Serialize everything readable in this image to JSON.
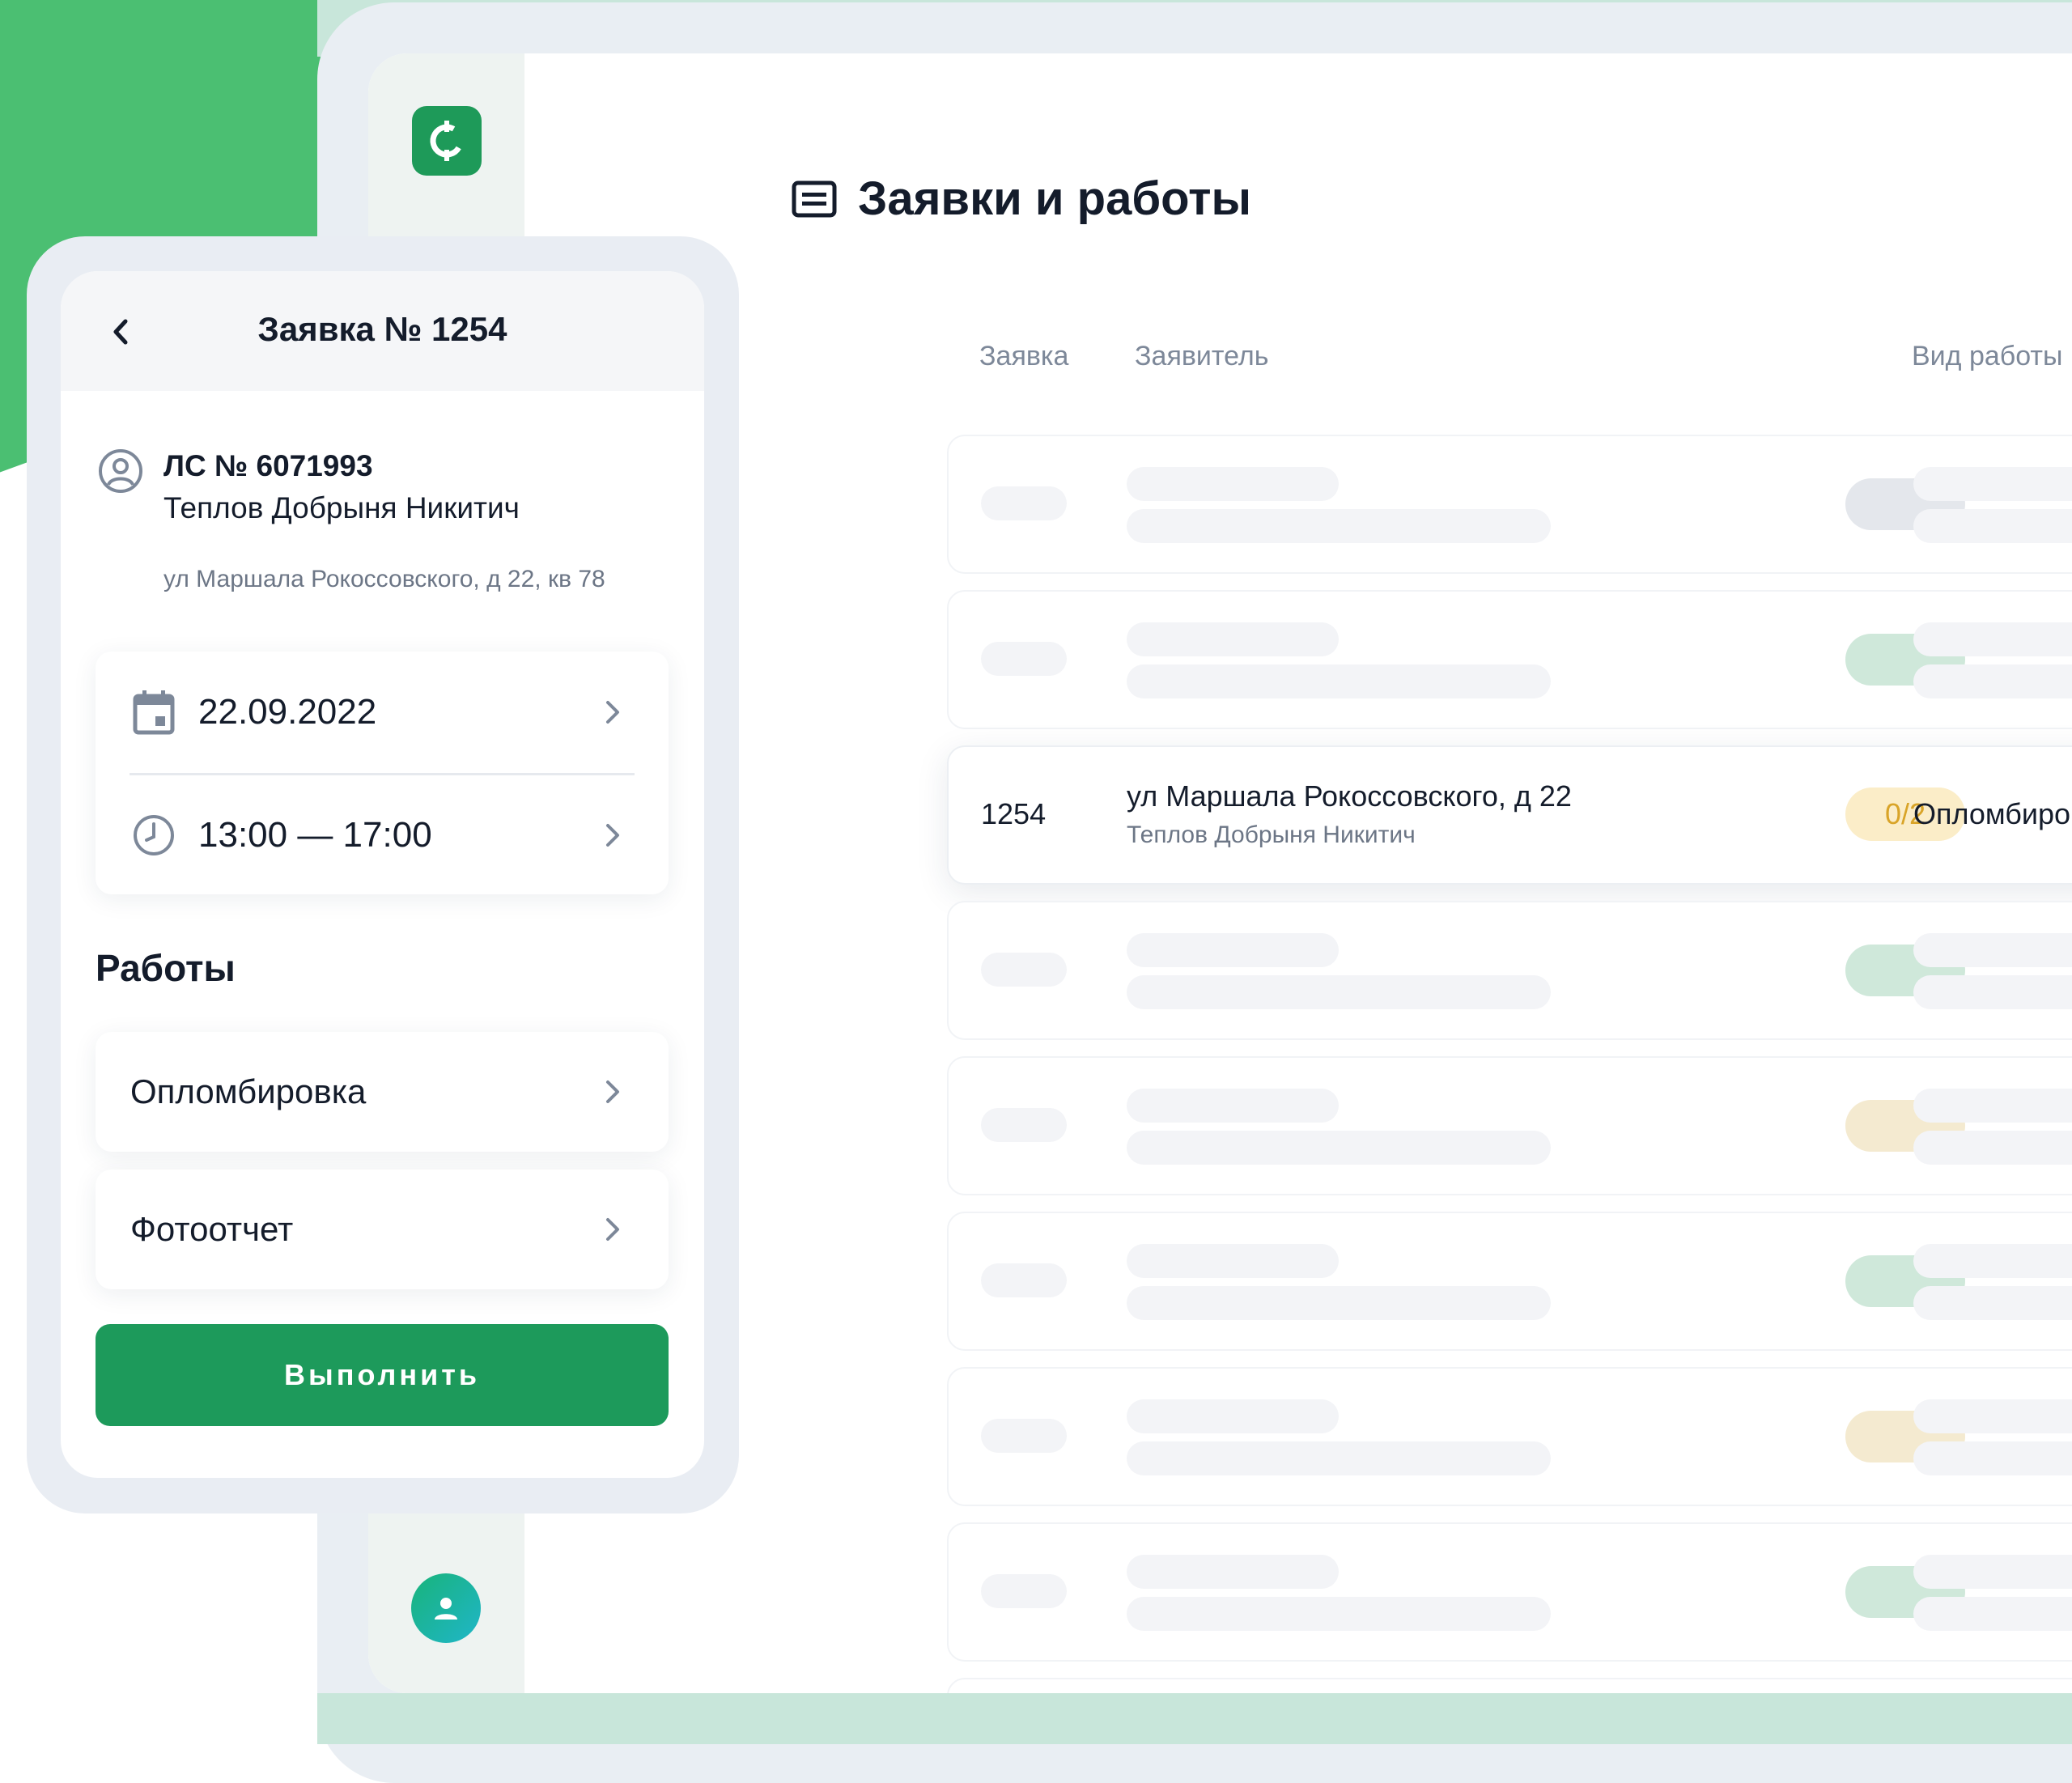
{
  "colors": {
    "brand_green": "#1d9a5b",
    "accent_green": "#4bbf72",
    "status_yellow_bg": "#fbedc8",
    "status_yellow_text": "#d9a428"
  },
  "desktop": {
    "sidebar": {
      "logo_icon": "app-logo-icon",
      "avatar_icon": "user-icon"
    },
    "page_title": "Заявки и работы",
    "title_icon": "list-icon",
    "columns": [
      "Заявка",
      "Заявитель",
      "Вид работы"
    ],
    "active_row": {
      "id": "1254",
      "address": "ул Маршала Рокоссовского, д 22",
      "applicant": "Теплов Добрыня Никитич",
      "progress": "0/2",
      "work_type": "Опломбировка"
    }
  },
  "mobile": {
    "title": "Заявка № 1254",
    "back_icon": "chevron-left-icon",
    "account": {
      "number": "ЛС № 6071993",
      "name": "Теплов Добрыня Никитич",
      "address": "ул Маршала Рокоссовского, д 22, кв 78"
    },
    "date": "22.09.2022",
    "time": "13:00 — 17:00",
    "works_title": "Работы",
    "works": [
      "Опломбировка",
      "Фотоотчет"
    ],
    "submit_label": "Выполнить"
  }
}
